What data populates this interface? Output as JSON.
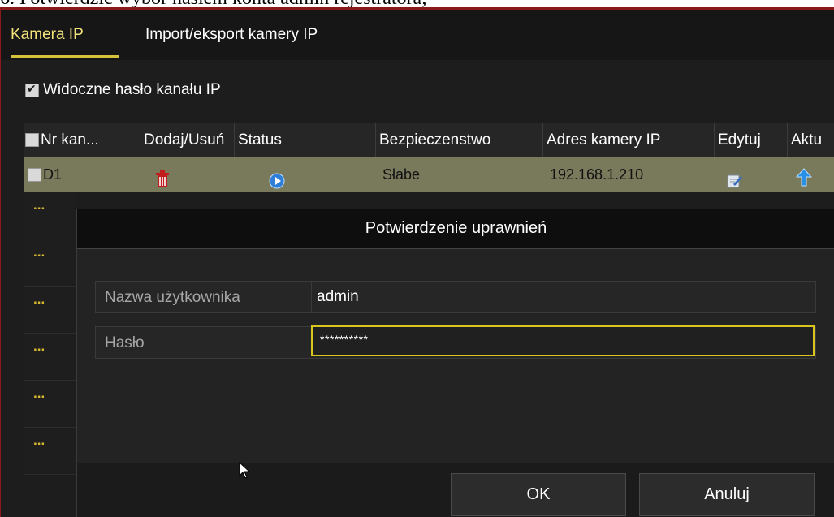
{
  "document": {
    "instruction": "6.   Potwierdzić wybór hasłem konta admin rejestratora;"
  },
  "tabs": [
    {
      "label": "Kamera IP",
      "active": true
    },
    {
      "label": "Import/eksport kamery IP",
      "active": false
    }
  ],
  "visible_password_checkbox": {
    "label": "Widoczne hasło kanału IP",
    "checked": true
  },
  "table": {
    "columns": [
      "Nr kan...",
      "Dodaj/Usuń",
      "Status",
      "Bezpieczenstwo",
      "Adres kamery IP",
      "Edytuj",
      "Aktu"
    ],
    "rows": [
      {
        "channel": "D1",
        "add_delete_icon": "trash-icon",
        "status_icon": "play-icon",
        "security": "Słabe",
        "ip": "192.168.1.210",
        "edit_icon": "edit-icon",
        "update_icon": "arrow-up-icon"
      }
    ],
    "more_rows": [
      "...",
      "...",
      "...",
      "...",
      "...",
      "..."
    ]
  },
  "dialog": {
    "title": "Potwierdzenie uprawnień",
    "username_label": "Nazwa użytkownika",
    "username_value": "admin",
    "password_label": "Hasło",
    "password_value": "**********",
    "ok_label": "OK",
    "cancel_label": "Anuluj"
  },
  "colors": {
    "accent_yellow": "#d9c51e",
    "selected_row": "#79795c",
    "background": "#1d1d1d"
  }
}
